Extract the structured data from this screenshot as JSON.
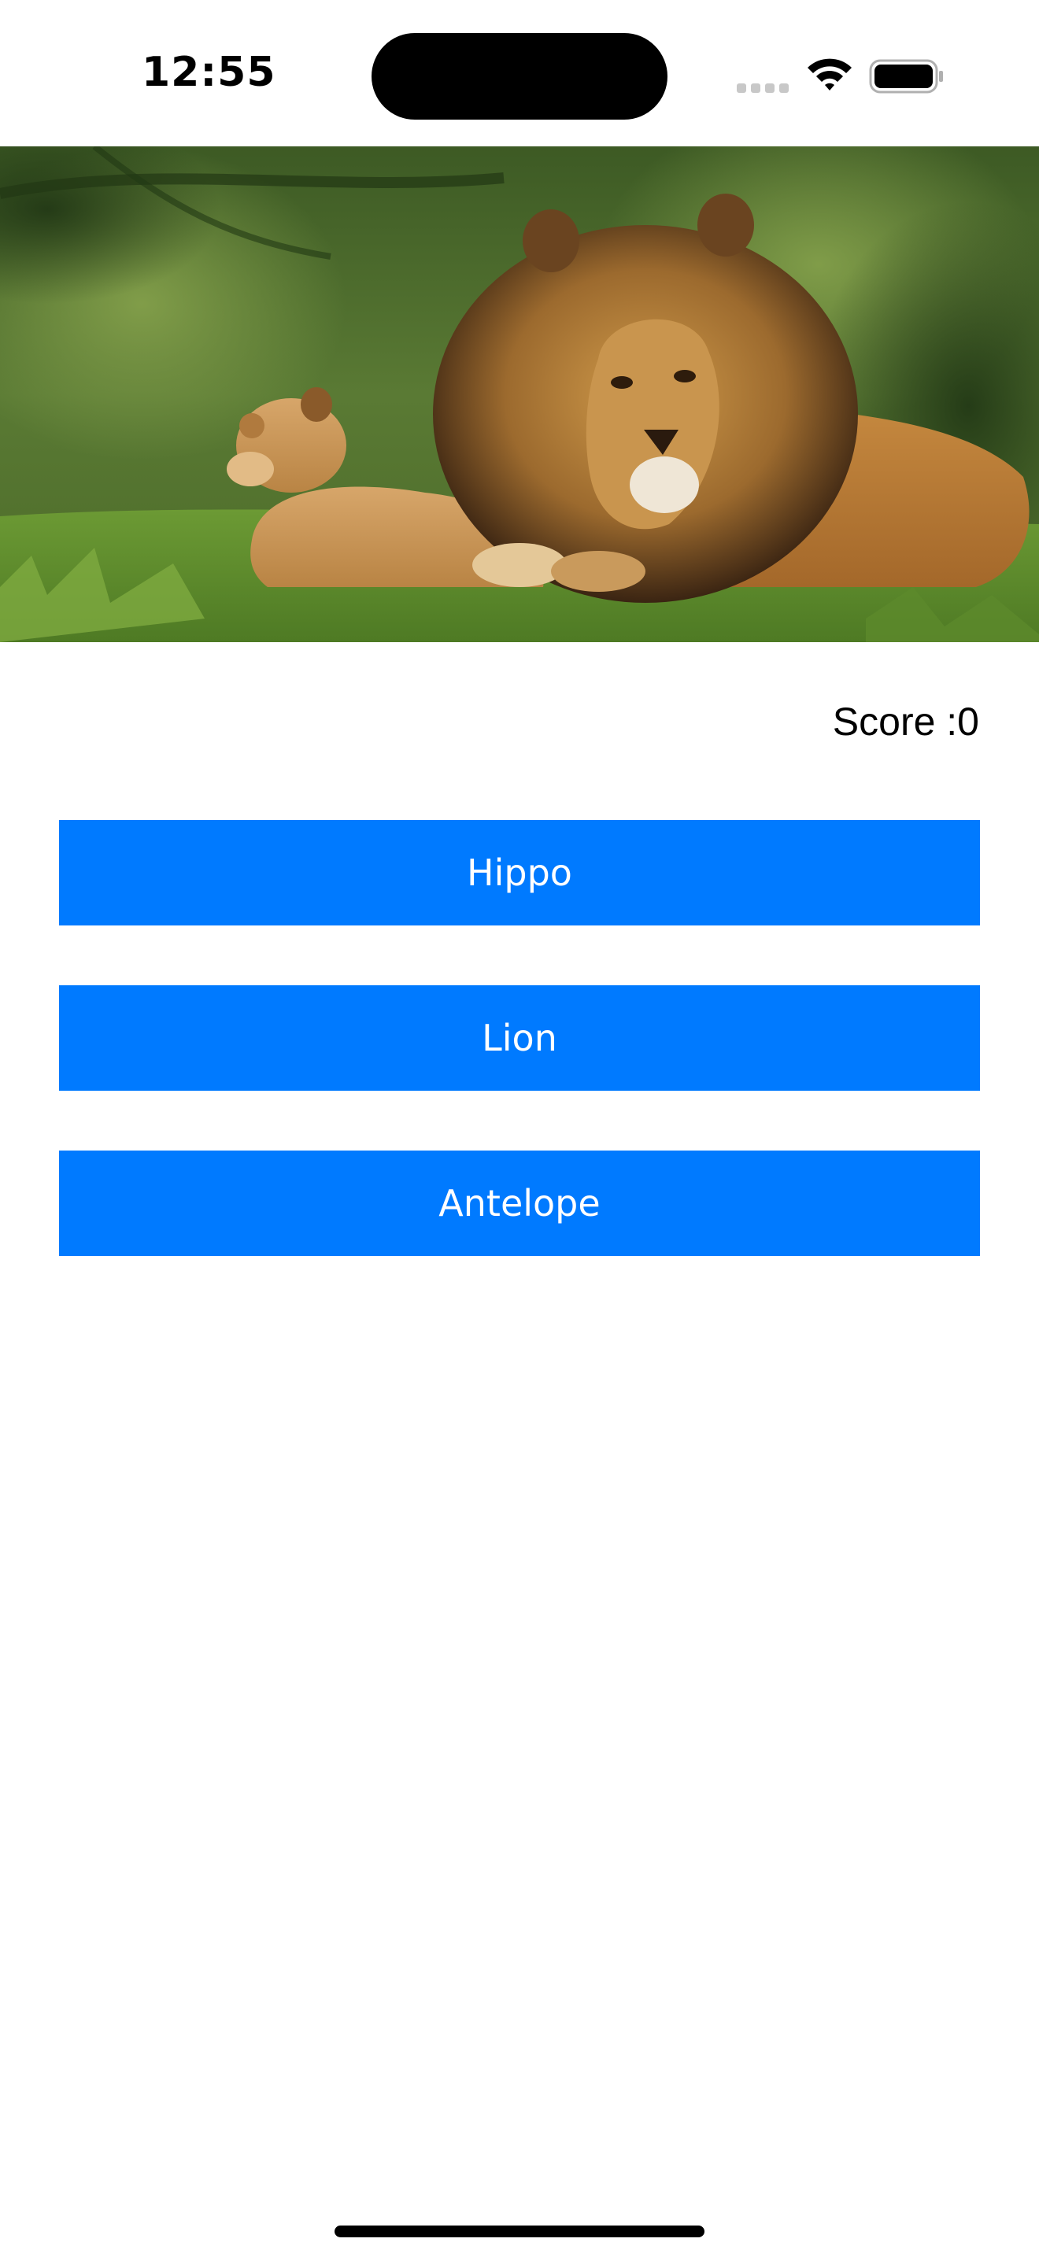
{
  "status_bar": {
    "time": "12:55",
    "icons": [
      "cellular-signal-icon",
      "wifi-icon",
      "battery-icon"
    ]
  },
  "hero": {
    "image": "lion-and-cub-photo"
  },
  "score": {
    "label": "Score :0"
  },
  "answers": [
    {
      "label": "Hippo"
    },
    {
      "label": "Lion"
    },
    {
      "label": "Antelope"
    }
  ],
  "colors": {
    "button_background": "#007aff",
    "button_text": "#ffffff",
    "background": "#ffffff",
    "text": "#000000"
  }
}
